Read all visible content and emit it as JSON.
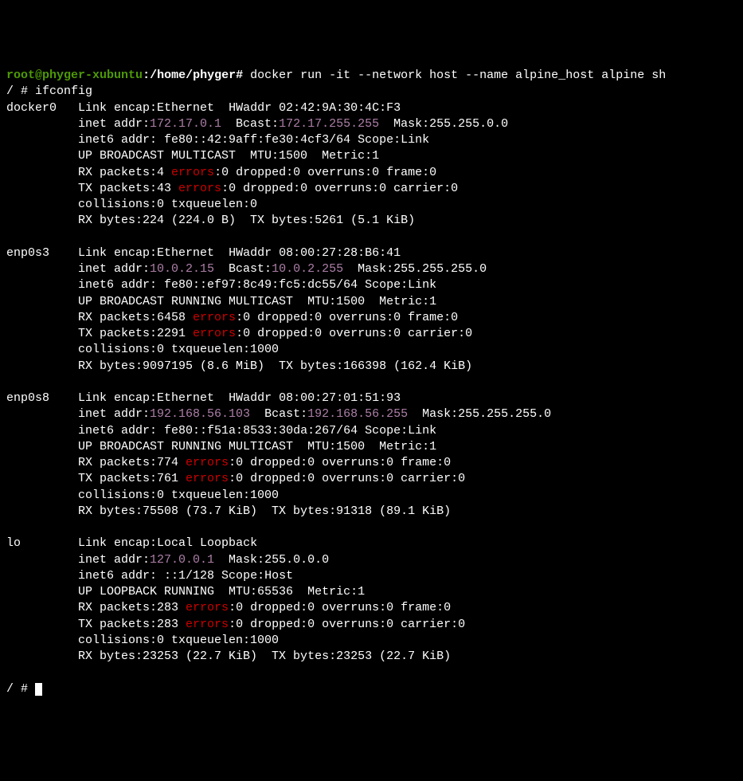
{
  "prompt": {
    "user": "root",
    "host": "phyger-xubuntu",
    "path": "/home/phyger",
    "cmd": "docker run -it --network host --name alpine_host alpine sh"
  },
  "shell_prompt": "/ # ",
  "ifconfig_cmd": "ifconfig",
  "docker0": {
    "name": "docker0",
    "encap": "Ethernet",
    "hwaddr": "02:42:9A:30:4C:F3",
    "inet": "172.17.0.1",
    "bcast": "172.17.255.255",
    "mask": "255.255.0.0",
    "inet6": "fe80::42:9aff:fe30:4cf3/64 Scope:Link",
    "flags": "UP BROADCAST MULTICAST  MTU:1500  Metric:1",
    "rx": "RX packets:4 ",
    "rx_err": "errors",
    "rx_rest": ":0 dropped:0 overruns:0 frame:0",
    "tx": "TX packets:43 ",
    "tx_err": "errors",
    "tx_rest": ":0 dropped:0 overruns:0 carrier:0",
    "coll": "collisions:0 txqueuelen:0",
    "bytes": "RX bytes:224 (224.0 B)  TX bytes:5261 (5.1 KiB)"
  },
  "enp0s3": {
    "name": "enp0s3",
    "encap": "Ethernet",
    "hwaddr": "08:00:27:28:B6:41",
    "inet": "10.0.2.15",
    "bcast": "10.0.2.255",
    "mask": "255.255.255.0",
    "inet6": "fe80::ef97:8c49:fc5:dc55/64 Scope:Link",
    "flags": "UP BROADCAST RUNNING MULTICAST  MTU:1500  Metric:1",
    "rx": "RX packets:6458 ",
    "rx_err": "errors",
    "rx_rest": ":0 dropped:0 overruns:0 frame:0",
    "tx": "TX packets:2291 ",
    "tx_err": "errors",
    "tx_rest": ":0 dropped:0 overruns:0 carrier:0",
    "coll": "collisions:0 txqueuelen:1000",
    "bytes": "RX bytes:9097195 (8.6 MiB)  TX bytes:166398 (162.4 KiB)"
  },
  "enp0s8": {
    "name": "enp0s8",
    "encap": "Ethernet",
    "hwaddr": "08:00:27:01:51:93",
    "inet": "192.168.56.103",
    "bcast": "192.168.56.255",
    "mask": "255.255.255.0",
    "inet6": "fe80::f51a:8533:30da:267/64 Scope:Link",
    "flags": "UP BROADCAST RUNNING MULTICAST  MTU:1500  Metric:1",
    "rx": "RX packets:774 ",
    "rx_err": "errors",
    "rx_rest": ":0 dropped:0 overruns:0 frame:0",
    "tx": "TX packets:761 ",
    "tx_err": "errors",
    "tx_rest": ":0 dropped:0 overruns:0 carrier:0",
    "coll": "collisions:0 txqueuelen:1000",
    "bytes": "RX bytes:75508 (73.7 KiB)  TX bytes:91318 (89.1 KiB)"
  },
  "lo": {
    "name": "lo",
    "encap": "Local Loopback",
    "inet": "127.0.0.1",
    "mask": "255.0.0.0",
    "inet6": "::1/128 Scope:Host",
    "flags": "UP LOOPBACK RUNNING  MTU:65536  Metric:1",
    "rx": "RX packets:283 ",
    "rx_err": "errors",
    "rx_rest": ":0 dropped:0 overruns:0 frame:0",
    "tx": "TX packets:283 ",
    "tx_err": "errors",
    "tx_rest": ":0 dropped:0 overruns:0 carrier:0",
    "coll": "collisions:0 txqueuelen:1000",
    "bytes": "RX bytes:23253 (22.7 KiB)  TX bytes:23253 (22.7 KiB)"
  }
}
